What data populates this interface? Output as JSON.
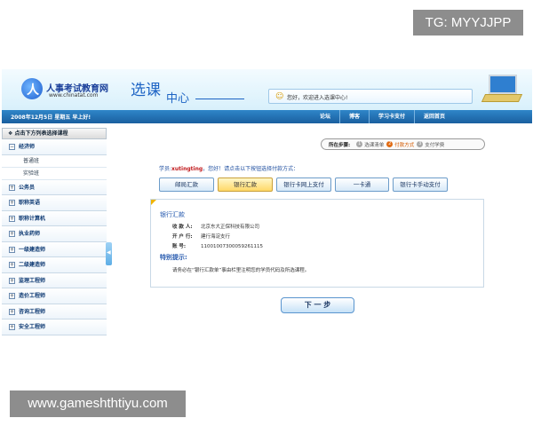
{
  "watermarks": {
    "top": "TG: MYYJJPP",
    "bottom": "www.gameshthtiyu.com"
  },
  "header": {
    "logo_title": "人事考试教育网",
    "logo_url": "www.chinatat.com",
    "brand_main": "选课",
    "brand_sub": "中心",
    "greeting": "您好，欢迎进入选课中心!"
  },
  "navbar": {
    "date": "2008年12月5日 星期五 早上好!",
    "links": [
      "论坛",
      "博客",
      "学习卡支付",
      "返回首页"
    ]
  },
  "sidebar": {
    "header": "点击下方列表选择课程",
    "items": [
      {
        "label": "经济师",
        "expanded": true,
        "children": [
          "普通班",
          "实验班"
        ]
      },
      {
        "label": "公务员"
      },
      {
        "label": "职称英语"
      },
      {
        "label": "职称计算机"
      },
      {
        "label": "执业药师"
      },
      {
        "label": "一级建造师"
      },
      {
        "label": "二级建造师"
      },
      {
        "label": "监理工程师"
      },
      {
        "label": "造价工程师"
      },
      {
        "label": "咨询工程师"
      },
      {
        "label": "安全工程师"
      }
    ]
  },
  "steps": {
    "label": "所在步骤:",
    "items": [
      {
        "num": "1",
        "label": "选课清单",
        "active": false
      },
      {
        "num": "2",
        "label": "付款方式",
        "active": true
      },
      {
        "num": "3",
        "label": "支付学费",
        "active": false
      }
    ]
  },
  "prompt": {
    "prefix": "学员:",
    "user": "xutingting",
    "suffix": "，您好！请点击以下按钮选择付款方式："
  },
  "payment_tabs": [
    {
      "label": "邮局汇款",
      "active": false
    },
    {
      "label": "银行汇款",
      "active": true
    },
    {
      "label": "银行卡网上支付",
      "active": false
    },
    {
      "label": "一卡通",
      "active": false
    },
    {
      "label": "银行卡手动支付",
      "active": false
    }
  ],
  "panel": {
    "title": "银行汇款",
    "rows": [
      {
        "label": "收 款 人:",
        "value": "北京东大正保科技有限公司"
      },
      {
        "label": "开 户 行:",
        "value": "建行海淀支行"
      },
      {
        "label": "账    号:",
        "value": "11001007300059261115"
      }
    ],
    "special_title": "特别提示:",
    "special_text": "请务必在“银行汇款单”事由栏里注明您的学员代码及所选课程。"
  },
  "next_button": "下 一 步",
  "colors": {
    "nav": "#1a5f9f",
    "active_step": "#e06a12",
    "active_tab": "#ffd866"
  }
}
